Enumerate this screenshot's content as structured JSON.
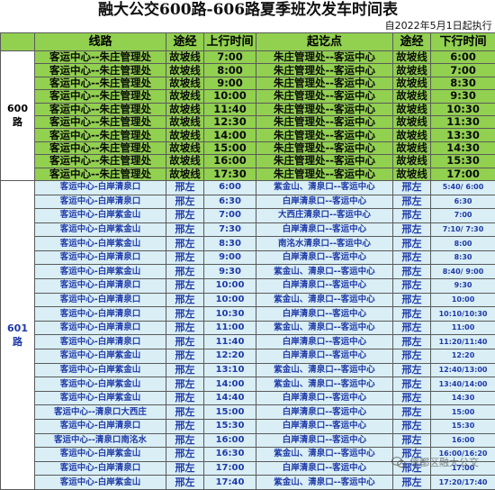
{
  "title": "融大公交600路-606路夏季班次发车时间表",
  "effective_date": "自2022年5月1日起执行",
  "headers": {
    "route": "线路",
    "via_up": "途经",
    "up_time": "上行时间",
    "stops": "起讫点",
    "via_down": "途经",
    "down_time": "下行时间"
  },
  "routes": [
    {
      "label": "600\n路",
      "rows": [
        {
          "line": "客运中心--朱庄管理处",
          "via_up": "故坡线",
          "up": "7:00",
          "stops": "朱庄管理处--客运中心",
          "via_down": "故坡线",
          "down": "6:00"
        },
        {
          "line": "客运中心--朱庄管理处",
          "via_up": "故坡线",
          "up": "8:00",
          "stops": "朱庄管理处--客运中心",
          "via_down": "故坡线",
          "down": "7:00"
        },
        {
          "line": "客运中心--朱庄管理处",
          "via_up": "故坡线",
          "up": "9:00",
          "stops": "朱庄管理处--客运中心",
          "via_down": "故坡线",
          "down": "8:30"
        },
        {
          "line": "客运中心--朱庄管理处",
          "via_up": "故坡线",
          "up": "10:00",
          "stops": "朱庄管理处--客运中心",
          "via_down": "故坡线",
          "down": "9:30"
        },
        {
          "line": "客运中心--朱庄管理处",
          "via_up": "故坡线",
          "up": "11:40",
          "stops": "朱庄管理处--客运中心",
          "via_down": "故坡线",
          "down": "10:30"
        },
        {
          "line": "客运中心--朱庄管理处",
          "via_up": "故坡线",
          "up": "12:30",
          "stops": "朱庄管理处--客运中心",
          "via_down": "故坡线",
          "down": "11:30"
        },
        {
          "line": "客运中心--朱庄管理处",
          "via_up": "故坡线",
          "up": "14:00",
          "stops": "朱庄管理处--客运中心",
          "via_down": "故坡线",
          "down": "13:30"
        },
        {
          "line": "客运中心--朱庄管理处",
          "via_up": "故坡线",
          "up": "15:00",
          "stops": "朱庄管理处--客运中心",
          "via_down": "故坡线",
          "down": "14:30"
        },
        {
          "line": "客运中心--朱庄管理处",
          "via_up": "故坡线",
          "up": "16:00",
          "stops": "朱庄管理处--客运中心",
          "via_down": "故坡线",
          "down": "15:30"
        },
        {
          "line": "客运中心--朱庄管理处",
          "via_up": "故坡线",
          "up": "17:30",
          "stops": "朱庄管理处--客运中心",
          "via_down": "故坡线",
          "down": "17:00"
        }
      ]
    },
    {
      "label": "601\n路",
      "rows": [
        {
          "line": "客运中心-白岸清泉口",
          "via_up": "邢左",
          "up": "6:00",
          "stops": "紫金山、清泉口--客运中心",
          "via_down": "邢左",
          "down": "5:40/ 6:00"
        },
        {
          "line": "客运中心-白岸清泉口",
          "via_up": "邢左",
          "up": "6:30",
          "stops": "白岸清泉口--客运中心",
          "via_down": "邢左",
          "down": "6:30"
        },
        {
          "line": "客运中心-白岸紫金山",
          "via_up": "邢左",
          "up": "7:00",
          "stops": "大西庄清泉口--客运中心",
          "via_down": "邢左",
          "down": "7:00"
        },
        {
          "line": "客运中心-白岸紫金山",
          "via_up": "邢左",
          "up": "7:30",
          "stops": "白岸清泉口--客运中心",
          "via_down": "邢左",
          "down": "7:10/ 7:30"
        },
        {
          "line": "客运中心-白岸紫金山",
          "via_up": "邢左",
          "up": "8:30",
          "stops": "南洺水清泉口--客运中心",
          "via_down": "邢左",
          "down": "8:00"
        },
        {
          "line": "客运中心-白岸清泉口",
          "via_up": "邢左",
          "up": "9:00",
          "stops": "白岸清泉口--客运中心",
          "via_down": "邢左",
          "down": "8:30"
        },
        {
          "line": "客运中心-白岸紫金山",
          "via_up": "邢左",
          "up": "9:30",
          "stops": "紫金山、清泉口--客运中心",
          "via_down": "邢左",
          "down": "8:40/ 9:00"
        },
        {
          "line": "客运中心-白岸清泉口",
          "via_up": "邢左",
          "up": "10:00",
          "stops": "白岸清泉口--客运中心",
          "via_down": "邢左",
          "down": "9:30"
        },
        {
          "line": "客运中心-白岸清泉口",
          "via_up": "邢左",
          "up": "10:00",
          "stops": "紫金山、清泉口--客运中心",
          "via_down": "邢左",
          "down": "10:00"
        },
        {
          "line": "客运中心-白岸清泉口",
          "via_up": "邢左",
          "up": "10:30",
          "stops": "白岸清泉口--客运中心",
          "via_down": "邢左",
          "down": "10:10/10:30"
        },
        {
          "line": "客运中心-白岸清泉口",
          "via_up": "邢左",
          "up": "11:00",
          "stops": "紫金山、清泉口--客运中心",
          "via_down": "邢左",
          "down": "11:00"
        },
        {
          "line": "客运中心-白岸清泉口",
          "via_up": "邢左",
          "up": "11:40",
          "stops": "白岸清泉口--客运中心",
          "via_down": "邢左",
          "down": "11:20/11:40"
        },
        {
          "line": "客运中心-白岸紫金山",
          "via_up": "邢左",
          "up": "12:20",
          "stops": "白岸清泉口--客运中心",
          "via_down": "邢左",
          "down": "12:20"
        },
        {
          "line": "客运中心-白岸紫金山",
          "via_up": "邢左",
          "up": "13:10",
          "stops": "紫金山、清泉口--客运中心",
          "via_down": "邢左",
          "down": "12:40/13:00"
        },
        {
          "line": "客运中心-白岸紫金山",
          "via_up": "邢左",
          "up": "14:00",
          "stops": "紫金山、清泉口--客运中心",
          "via_down": "邢左",
          "down": "13:40/14:00"
        },
        {
          "line": "客运中心-白岸紫金山",
          "via_up": "邢左",
          "up": "14:40",
          "stops": "白岸清泉口--客运中心",
          "via_down": "邢左",
          "down": "14:30"
        },
        {
          "line": "客运中心--清泉口大西庄",
          "via_up": "邢左",
          "up": "15:00",
          "stops": "白岸清泉口--客运中心",
          "via_down": "邢左",
          "down": "15:00"
        },
        {
          "line": "客运中心-白岸清泉口",
          "via_up": "邢左",
          "up": "15:30",
          "stops": "白岸清泉口--客运中心",
          "via_down": "邢左",
          "down": "15:30"
        },
        {
          "line": "客运中心--清泉口南洺水",
          "via_up": "邢左",
          "up": "16:00",
          "stops": "白岸清泉口--客运中心",
          "via_down": "邢左",
          "down": "16:00"
        },
        {
          "line": "客运中心-白岸紫金山",
          "via_up": "邢左",
          "up": "16:30",
          "stops": "紫金山、清泉口--客运中心",
          "via_down": "邢左",
          "down": "16:00/16:20"
        },
        {
          "line": "客运中心-白岸清泉口",
          "via_up": "邢左",
          "up": "17:00",
          "stops": "白岸清泉口--客运中心",
          "via_down": "邢左",
          "down": "17:00"
        },
        {
          "line": "客运中心-白岸紫金山",
          "via_up": "邢左",
          "up": "17:40",
          "stops": "紫金山、清泉口--客运中心",
          "via_down": "邢左",
          "down": "17:20/17:40"
        }
      ]
    }
  ],
  "watermark": {
    "text": "信都区融大公交",
    "icon": "wechat-icon"
  }
}
